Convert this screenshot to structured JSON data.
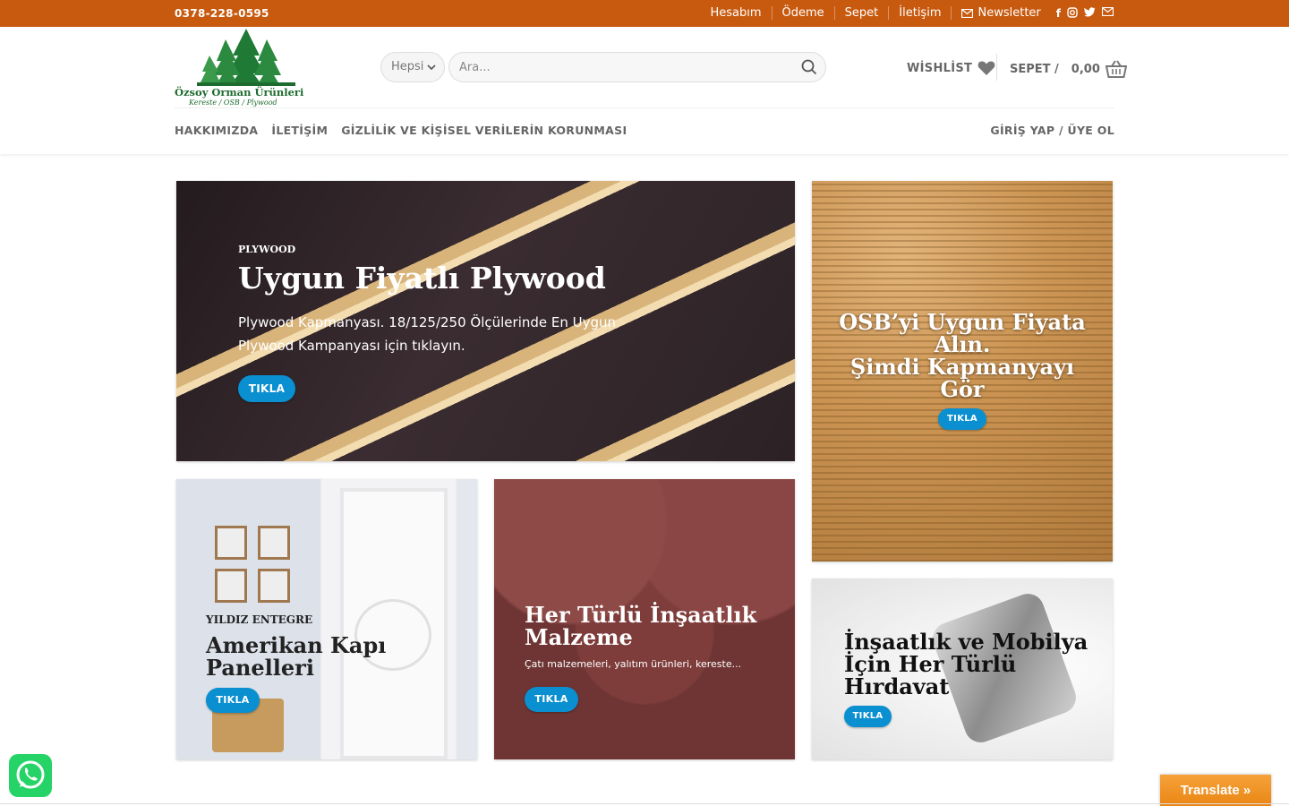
{
  "topbar": {
    "phone": "0378-228-0595",
    "links": [
      "Hesabım",
      "Ödeme",
      "Sepet",
      "İletişim"
    ],
    "newsletter": "Newsletter",
    "social_icons": [
      "facebook-icon",
      "instagram-icon",
      "twitter-icon",
      "email-icon"
    ]
  },
  "header": {
    "logo_brand": "Özsoy Orman Ürünleri",
    "logo_tagline": "Kereste / OSB / Plywood",
    "category_select": "Hepsi",
    "search_placeholder": "Ara...",
    "wishlist_label": "WİSHLİST",
    "cart_label": "SEPET /",
    "cart_total": "0,00",
    "nav": [
      "HAKKIMIZDA",
      "İLETİŞİM",
      "GİZLİLİK VE KİŞİSEL VERİLERİN KORUNMASI"
    ],
    "login": "GİRİŞ YAP / ÜYE OL"
  },
  "banners": {
    "plywood": {
      "category": "PLYWOOD",
      "title": "Uygun Fiyatlı Plywood",
      "description": "Plywood Kapmanyası. 18/125/250 Ölçülerinde En Uygun Plywood Kampanyası için tıklayın.",
      "button": "TIKLA"
    },
    "osb": {
      "title_line1": "OSB’yi Uygun Fiyata",
      "title_line2": "Alın.",
      "title_line3": "Şimdi Kapmanyayı",
      "title_line4": "Gör",
      "button": "TIKLA"
    },
    "door": {
      "category": "YILDIZ ENTEGRE",
      "title_line1": "Amerikan Kapı",
      "title_line2": "Panelleri",
      "button": "TIKLA"
    },
    "roof": {
      "title_line1": "Her Türlü İnşaatlık",
      "title_line2": "Malzeme",
      "description": "Çatı malzemeleri, yalıtım ürünleri, kereste...",
      "button": "TIKLA"
    },
    "hardware": {
      "title_line1": "İnşaatlık ve Mobilya",
      "title_line2": "İçin Her Türlü",
      "title_line3": "Hırdavat",
      "button": "TIKLA"
    }
  },
  "floating": {
    "translate": "Translate »"
  },
  "colors": {
    "topbar": "#c85a0f",
    "button": "#0a8fd0",
    "whatsapp": "#25d366",
    "translate": "#e98614"
  }
}
